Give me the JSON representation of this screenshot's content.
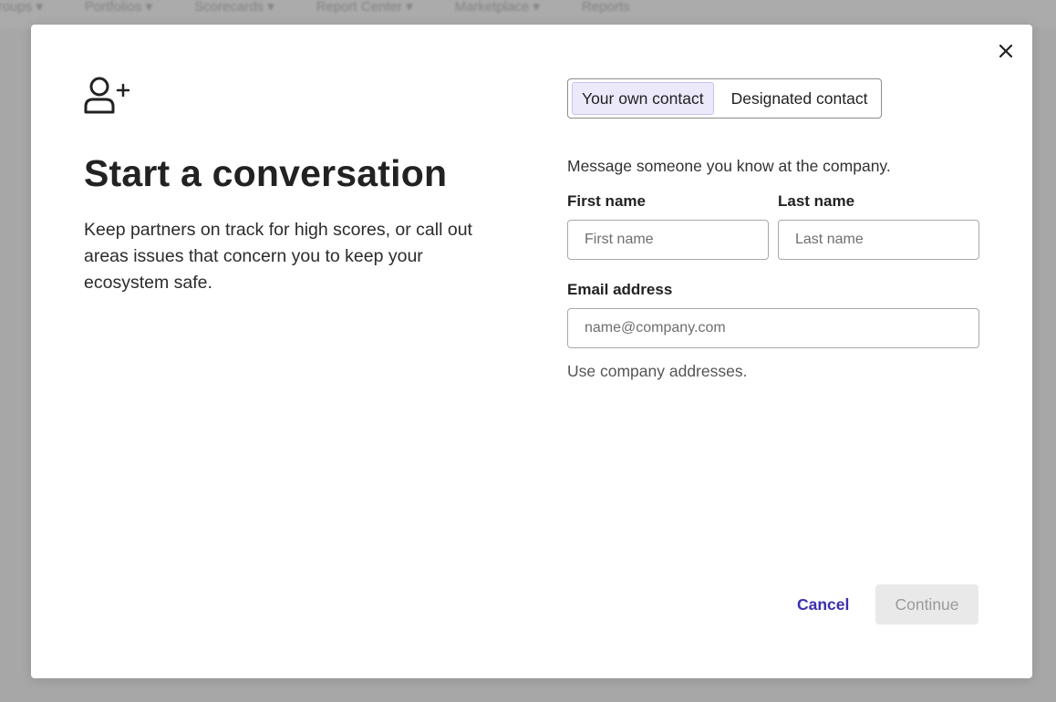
{
  "background_nav": [
    "Groups ▾",
    "Portfolios ▾",
    "Scorecards ▾",
    "Report Center ▾",
    "Marketplace ▾",
    "Reports"
  ],
  "modal": {
    "close_icon": "close-icon",
    "hero_icon": "user-plus-icon",
    "title": "Start a conversation",
    "description": "Keep partners on track for high scores, or call out areas issues that concern you to keep your ecosystem safe.",
    "tabs": [
      {
        "label": "Your own contact",
        "selected": true
      },
      {
        "label": "Designated contact",
        "selected": false
      }
    ],
    "helper_text": "Message someone you know at the company.",
    "first_name": {
      "label": "First name",
      "placeholder": "First name",
      "value": ""
    },
    "last_name": {
      "label": "Last name",
      "placeholder": "Last name",
      "value": ""
    },
    "email": {
      "label": "Email address",
      "placeholder": "name@company.com",
      "value": ""
    },
    "email_hint": "Use company addresses.",
    "cancel_label": "Cancel",
    "continue_label": "Continue"
  },
  "colors": {
    "accent": "#3b2fb0",
    "tab_selected_bg": "#ece9fb",
    "overlay": "#b9b9b9",
    "disabled_button_bg": "#e9e9e9"
  }
}
